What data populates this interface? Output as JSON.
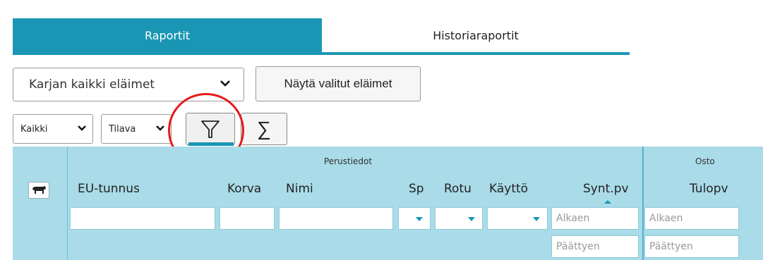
{
  "tabs": {
    "reports": "Raportit",
    "history_reports": "Historiaraportit"
  },
  "herd_select": {
    "value": "Karjan kaikki eläimet"
  },
  "show_selected_button": "Näytä valitut eläimet",
  "toolbar": {
    "scope_select": "Kaikki",
    "view_select": "Tilava",
    "sum_symbol": "∑"
  },
  "colors": {
    "accent": "#1a96b4",
    "grid_bg": "#a9dbe8",
    "annotation": "#e41b1b"
  },
  "grid": {
    "group_basic": "Perustiedot",
    "group_purchase": "Osto",
    "columns": {
      "eu_id": "EU-tunnus",
      "ear": "Korva",
      "name": "Nimi",
      "sex": "Sp",
      "breed": "Rotu",
      "use": "Käyttö",
      "birth_date": "Synt.pv",
      "arrival_date": "Tulopv"
    },
    "filters": {
      "birth_start": "Alkaen",
      "birth_end": "Päättyen",
      "arrival_start": "Alkaen",
      "arrival_end": "Päättyen"
    }
  }
}
